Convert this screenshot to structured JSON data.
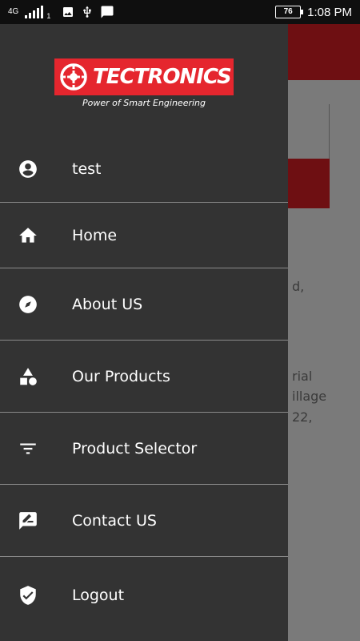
{
  "status_bar": {
    "network": "4G",
    "sim_slot": "1",
    "battery": "76",
    "time": "1:08 PM"
  },
  "brand": {
    "name": "TECTRONICS",
    "tagline": "Power of Smart Engineering",
    "color": "#e5262e"
  },
  "menu": {
    "items": [
      {
        "label": "test",
        "icon": "account-circle-icon"
      },
      {
        "label": "Home",
        "icon": "home-icon"
      },
      {
        "label": "About US",
        "icon": "compass-icon"
      },
      {
        "label": "Our Products",
        "icon": "shapes-icon"
      },
      {
        "label": "Product Selector",
        "icon": "filter-icon"
      },
      {
        "label": "Contact US",
        "icon": "feedback-icon"
      },
      {
        "label": "Logout",
        "icon": "shield-check-icon"
      }
    ]
  },
  "background": {
    "text_fragments": [
      "d,",
      "rial",
      "illage",
      "22,"
    ],
    "accent": "#6e0f12"
  }
}
